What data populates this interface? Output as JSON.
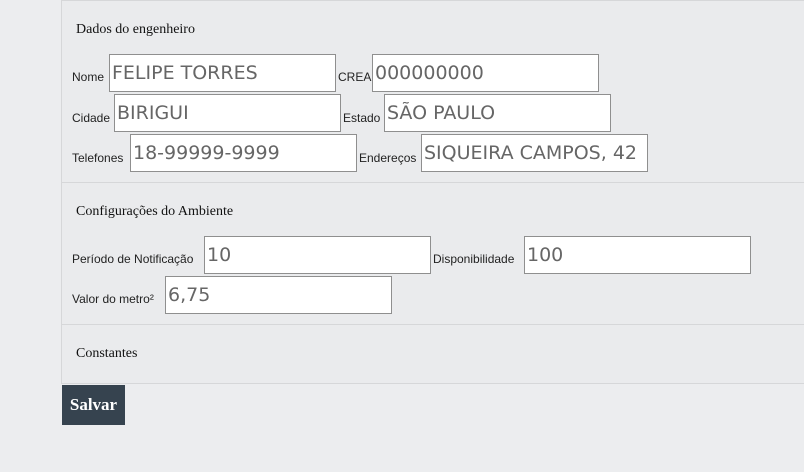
{
  "engineer": {
    "title": "Dados do engenheiro",
    "name": {
      "label": "Nome",
      "value": "FELIPE TORRES"
    },
    "crea": {
      "label": "CREA",
      "value": "000000000"
    },
    "city": {
      "label": "Cidade",
      "value": "BIRIGUI"
    },
    "state": {
      "label": "Estado",
      "value": "SÃO PAULO"
    },
    "phones": {
      "label": "Telefones",
      "value": "18-99999-9999"
    },
    "addresses": {
      "label": "Endereços",
      "value": "SIQUEIRA CAMPOS, 42"
    }
  },
  "environment": {
    "title": "Configurações do Ambiente",
    "notification_period": {
      "label": "Período de Notificação",
      "value": "10"
    },
    "availability": {
      "label": "Disponibilidade",
      "value": "100"
    },
    "price_per_m2": {
      "label": "Valor do metro²",
      "value": "6,75"
    }
  },
  "constants": {
    "title": "Constantes"
  },
  "actions": {
    "save_label": "Salvar"
  }
}
